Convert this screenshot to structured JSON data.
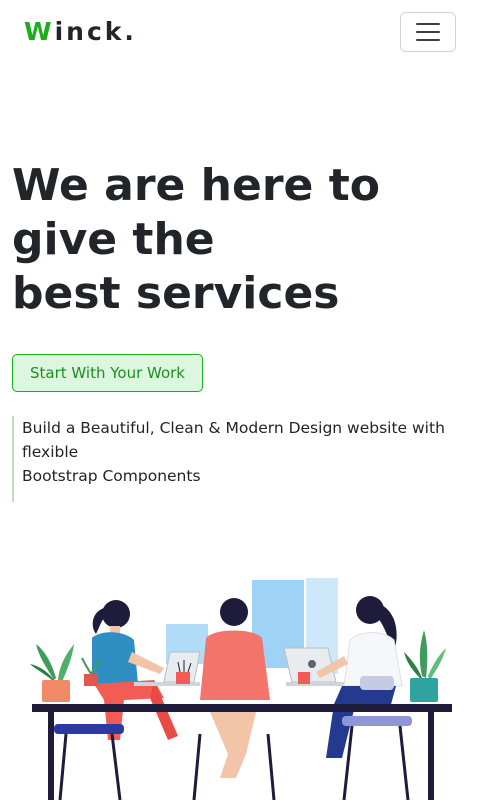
{
  "brand": {
    "first_letter": "W",
    "rest": "inck.",
    "accent_color": "#1aae1a"
  },
  "navbar": {
    "toggler_icon": "hamburger-menu-icon"
  },
  "hero": {
    "title_lines": [
      "We are here to",
      "give the",
      "best services"
    ],
    "cta_label": "Start With Your Work",
    "tagline_lines": [
      "Build a Beautiful, Clean & Modern Design website with",
      "flexible",
      "Bootstrap Components"
    ]
  },
  "illustration": {
    "subject": "three people working at a desk with laptops"
  }
}
